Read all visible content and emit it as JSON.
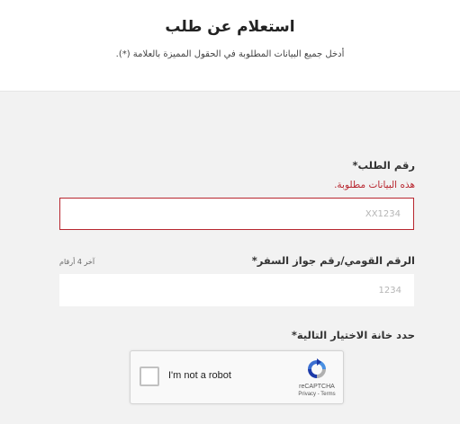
{
  "header": {
    "title": "استعلام عن طلب",
    "subtitle": "أدخل جميع البيانات المطلوبة في الحقول المميزة بالعلامة (*)."
  },
  "form": {
    "request_number": {
      "label": "رقم الطلب*",
      "error": "هذه البيانات مطلوبة.",
      "placeholder": "XX1234",
      "value": ""
    },
    "national_id": {
      "label": "الرقم القومي/رقم جواز السفر*",
      "hint": "آخر 4 أرقام",
      "placeholder": "1234",
      "value": ""
    },
    "captcha": {
      "label": "حدد خانة الاختيار التالية*",
      "checkbox_text": "I'm not a robot",
      "brand": "reCAPTCHA",
      "privacy": "Privacy",
      "separator": " - ",
      "terms": "Terms"
    }
  },
  "colors": {
    "error": "#b8262f",
    "background": "#f2f2f2"
  }
}
